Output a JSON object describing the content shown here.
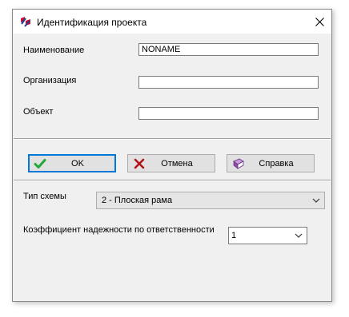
{
  "window": {
    "title": "Идентификация проекта",
    "icon": "app-logo-icon",
    "close_icon": "close-icon"
  },
  "fields": {
    "name": {
      "label": "Наименование",
      "value": "NONAME"
    },
    "organization": {
      "label": "Организация",
      "value": ""
    },
    "object": {
      "label": "Объект",
      "value": ""
    }
  },
  "buttons": {
    "ok": {
      "label": "OK",
      "icon": "checkmark-icon"
    },
    "cancel": {
      "label": "Отмена",
      "icon": "cross-icon"
    },
    "help": {
      "label": "Справка",
      "icon": "book-icon"
    }
  },
  "scheme": {
    "label": "Тип схемы",
    "selected": "2 - Плоская рама"
  },
  "reliability": {
    "label": "Коэффициент надежности по ответственности",
    "selected": "1"
  },
  "colors": {
    "check_green": "#22a83a",
    "cross_red": "#b3141b",
    "book_purple": "#8a4fa3",
    "focus_blue": "#0078d7"
  }
}
